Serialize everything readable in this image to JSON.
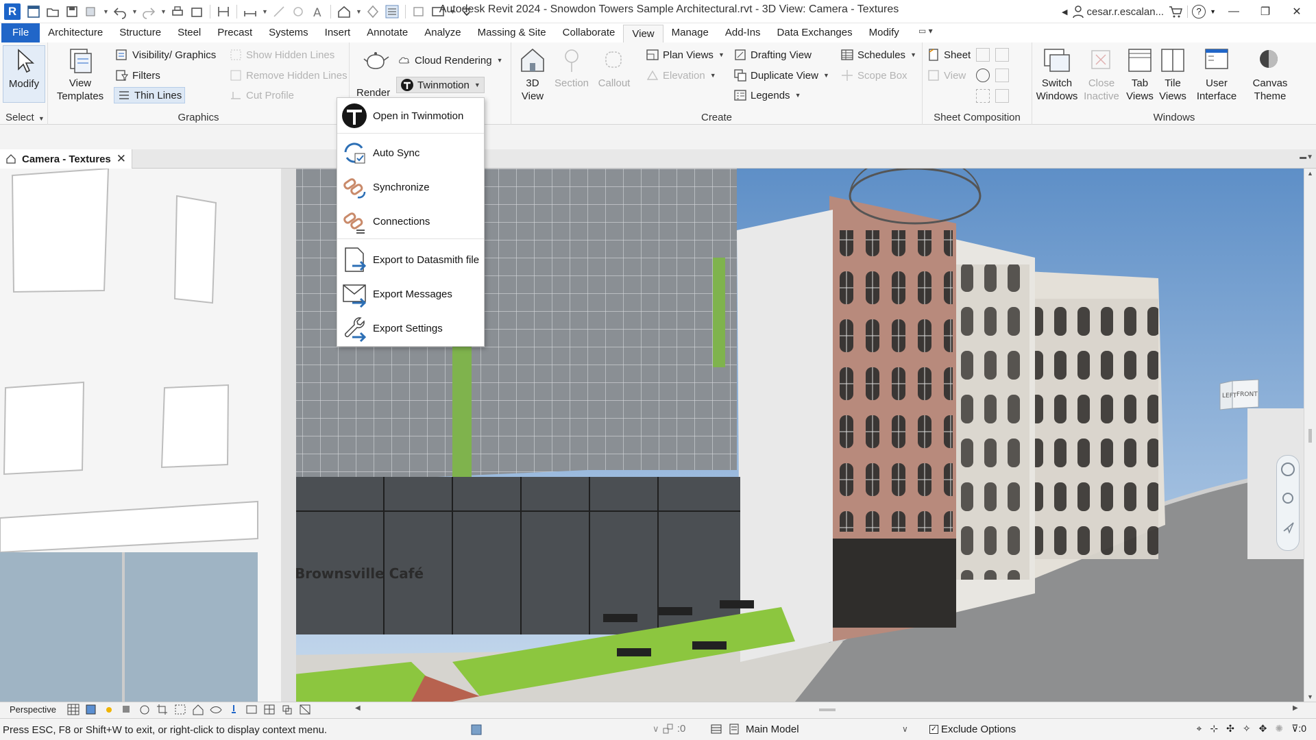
{
  "window": {
    "title": "Autodesk Revit 2024 - Snowdon Towers Sample Architectural.rvt - 3D View: Camera - Textures",
    "user": "cesar.r.escalan...",
    "help": "?"
  },
  "app_logo": "R",
  "tabs": [
    "File",
    "Architecture",
    "Structure",
    "Steel",
    "Precast",
    "Systems",
    "Insert",
    "Annotate",
    "Analyze",
    "Massing & Site",
    "Collaborate",
    "View",
    "Manage",
    "Add-Ins",
    "Data Exchanges",
    "Modify"
  ],
  "active_tab": "View",
  "ribbon": {
    "select": {
      "modify": "Modify",
      "panel": "Select"
    },
    "graphics": {
      "panel": "Graphics",
      "view_templates": [
        "View",
        "Templates"
      ],
      "visibility_graphics": "Visibility/ Graphics",
      "filters": "Filters",
      "thin_lines": "Thin Lines",
      "show_hidden_lines": "Show Hidden Lines",
      "remove_hidden_lines": "Remove Hidden Lines",
      "cut_profile": "Cut Profile"
    },
    "presentation": {
      "render": "Render",
      "cloud_rendering": "Cloud Rendering",
      "twinmotion": "Twinmotion"
    },
    "create": {
      "panel": "Create",
      "view_3d": [
        "3D",
        "View"
      ],
      "section": "Section",
      "callout": "Callout",
      "plan_views": "Plan Views",
      "elevation": "Elevation",
      "legends": "Legends",
      "drafting_view": "Drafting View",
      "duplicate_view": "Duplicate View",
      "schedules": "Schedules",
      "scope_box": "Scope Box"
    },
    "sheet_composition": {
      "panel": "Sheet Composition",
      "sheet": "Sheet",
      "view": "View"
    },
    "windows": {
      "panel": "Windows",
      "switch_windows": [
        "Switch",
        "Windows"
      ],
      "close_inactive": [
        "Close",
        "Inactive"
      ],
      "tab_views": [
        "Tab",
        "Views"
      ],
      "tile_views": [
        "Tile",
        "Views"
      ],
      "user_interface": [
        "User",
        "Interface"
      ],
      "canvas_theme": [
        "Canvas",
        "Theme"
      ]
    }
  },
  "twinmotion_menu": [
    {
      "label": "Open in Twinmotion",
      "icon": "twinmotion-logo-icon"
    },
    {
      "label": "Auto Sync",
      "icon": "auto-sync-icon"
    },
    {
      "label": "Synchronize",
      "icon": "synchronize-icon"
    },
    {
      "label": "Connections",
      "icon": "connections-icon"
    },
    {
      "label": "Export to Datasmith file",
      "icon": "export-datasmith-icon"
    },
    {
      "label": "Export Messages",
      "icon": "export-messages-icon"
    },
    {
      "label": "Export Settings",
      "icon": "export-settings-icon"
    }
  ],
  "view_tab": {
    "label": "Camera - Textures"
  },
  "viewport": {
    "signage": "Brownsville Café",
    "viewcube_faces": [
      "LEFT",
      "FRONT"
    ]
  },
  "view_control": {
    "mode": "Perspective"
  },
  "status": {
    "message": "Press ESC, F8 or Shift+W to exit, or right-click to display context menu.",
    "count_a": ":0",
    "workset": "Main Model",
    "exclude_options": "Exclude Options",
    "filter_count": ":0"
  },
  "colors": {
    "accent": "#2166c8",
    "sky": "#8fb4d9",
    "brick": "#b9897a",
    "grass": "#8cc63f"
  }
}
